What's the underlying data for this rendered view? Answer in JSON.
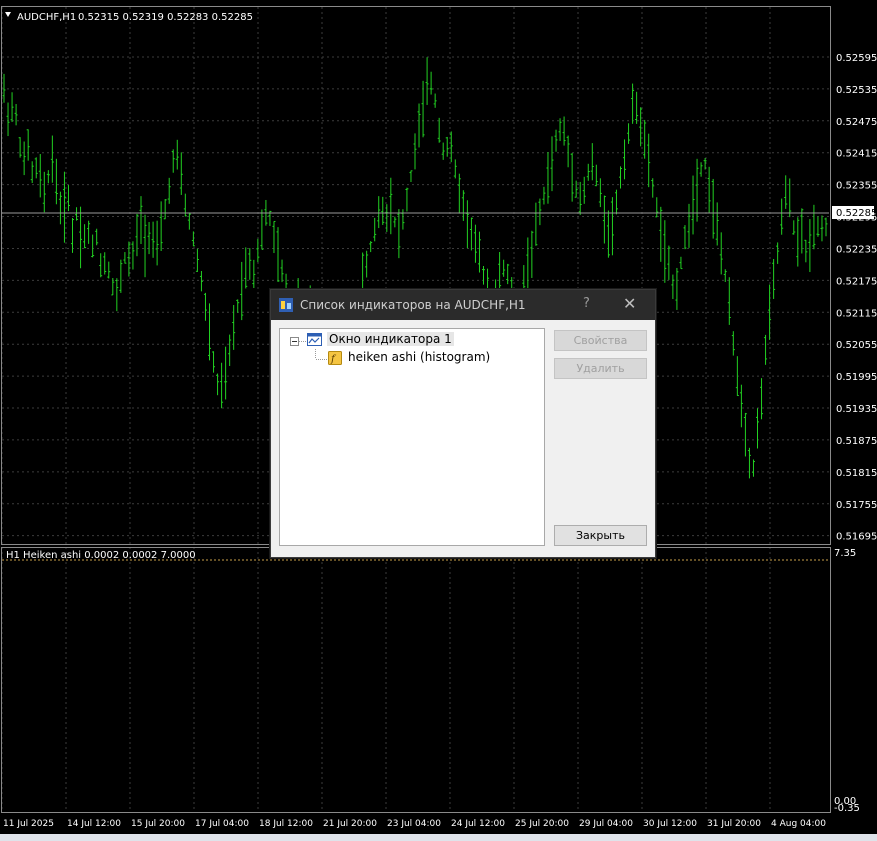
{
  "chart_data": {
    "type": "bar",
    "title": "AUDCHF,H1",
    "ohlc_readout": "0.52315 0.52319 0.52283 0.52285",
    "price_ticks": [
      "0.52595",
      "0.52535",
      "0.52475",
      "0.52415",
      "0.52355",
      "0.52295",
      "0.52235",
      "0.52175",
      "0.52115",
      "0.52055",
      "0.51995",
      "0.51935",
      "0.51875",
      "0.51815",
      "0.51755",
      "0.51695"
    ],
    "ylim": [
      0.51685,
      0.52625
    ],
    "current_price": "0.52285",
    "time_labels": [
      "11 Jul 2025",
      "14 Jul 12:00",
      "15 Jul 20:00",
      "17 Jul 04:00",
      "18 Jul 12:00",
      "21 Jul 20:00",
      "23 Jul 04:00",
      "24 Jul 12:00",
      "25 Jul 20:00",
      "29 Jul 04:00",
      "30 Jul 12:00",
      "31 Jul 20:00",
      "4 Aug 04:00"
    ],
    "price_series": [
      0.5253,
      0.5248,
      0.5251,
      0.5245,
      0.5239,
      0.5243,
      0.5236,
      0.524,
      0.5232,
      0.5237,
      0.5241,
      0.5234,
      0.5229,
      0.5235,
      0.5226,
      0.5231,
      0.5224,
      0.5228,
      0.5223,
      0.5226,
      0.5219,
      0.5222,
      0.5217,
      0.5214,
      0.5219,
      0.5223,
      0.522,
      0.5225,
      0.5229,
      0.5224,
      0.5228,
      0.5222,
      0.5226,
      0.5231,
      0.5236,
      0.5242,
      0.5238,
      0.5232,
      0.5228,
      0.5224,
      0.5219,
      0.5214,
      0.5207,
      0.5201,
      0.5196,
      0.5198,
      0.5203,
      0.5209,
      0.5214,
      0.5218,
      0.5222,
      0.5219,
      0.5224,
      0.5228,
      0.5231,
      0.5226,
      0.5222,
      0.5218,
      0.5214,
      0.5211,
      0.5215,
      0.5213,
      0.521,
      0.5212,
      0.5209,
      0.5206,
      0.5203,
      0.5205,
      0.5202,
      0.52,
      0.5204,
      0.5208,
      0.5212,
      0.5216,
      0.522,
      0.5224,
      0.5228,
      0.5232,
      0.5229,
      0.5233,
      0.5228,
      0.5226,
      0.5231,
      0.5236,
      0.5242,
      0.5247,
      0.5251,
      0.5256,
      0.5252,
      0.5246,
      0.5241,
      0.5244,
      0.5239,
      0.5235,
      0.5231,
      0.5228,
      0.5225,
      0.5222,
      0.5219,
      0.5216,
      0.5214,
      0.5217,
      0.522,
      0.5218,
      0.5215,
      0.5212,
      0.5216,
      0.522,
      0.5224,
      0.5228,
      0.5232,
      0.5236,
      0.524,
      0.5244,
      0.5247,
      0.5243,
      0.5239,
      0.5235,
      0.5232,
      0.5236,
      0.524,
      0.5237,
      0.5233,
      0.5229,
      0.5226,
      0.5231,
      0.5237,
      0.5242,
      0.5247,
      0.5252,
      0.5248,
      0.5243,
      0.5238,
      0.5233,
      0.5228,
      0.5223,
      0.5219,
      0.5215,
      0.5219,
      0.5224,
      0.5229,
      0.5233,
      0.5237,
      0.5241,
      0.5236,
      0.5231,
      0.5226,
      0.5221,
      0.5214,
      0.5206,
      0.5199,
      0.5193,
      0.5186,
      0.5181,
      0.5189,
      0.5198,
      0.5207,
      0.5215,
      0.5222,
      0.5229,
      0.5235,
      0.523,
      0.5224,
      0.5227,
      0.5222,
      0.5226,
      0.5229,
      0.5227,
      0.5228
    ],
    "indicator_label": "H1 Heiken ashi  0.0002 0.0002 7.0000",
    "indicator_ticks": [
      "7.35",
      "0.00",
      "-0.35"
    ],
    "grid": true
  },
  "dialog": {
    "title": "Список индикаторов на AUDCHF,H1",
    "help": "?",
    "close": "✕",
    "tree": {
      "window_label": "Окно индикатора 1",
      "indicator_label": "heiken ashi (histogram)"
    },
    "buttons": {
      "properties": "Свойства",
      "delete": "Удалить",
      "close": "Закрыть"
    }
  },
  "colors": {
    "background": "#000000",
    "bars": "#22d122",
    "grid": "#3c3c3c",
    "text": "#ffffff",
    "level_line": "#c8a04a"
  }
}
